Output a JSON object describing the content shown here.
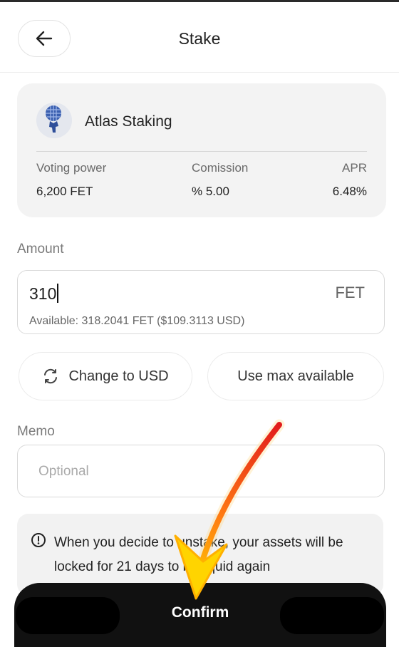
{
  "header": {
    "title": "Stake"
  },
  "validator": {
    "name": "Atlas Staking",
    "stats": [
      {
        "label": "Voting power",
        "value": "6,200 FET"
      },
      {
        "label": "Comission",
        "value": "% 5.00"
      },
      {
        "label": "APR",
        "value": "6.48%"
      }
    ]
  },
  "amount": {
    "label": "Amount",
    "value": "310",
    "unit": "FET",
    "available": "Available: 318.2041 FET ($109.3113 USD)"
  },
  "actions": {
    "change_currency": "Change to USD",
    "use_max": "Use max available"
  },
  "memo": {
    "label": "Memo",
    "placeholder": "Optional"
  },
  "notice": {
    "text": "When you decide to unstake, your assets will be locked for 21 days to be liquid again"
  },
  "confirm": {
    "label": "Confirm"
  },
  "colors": {
    "confirm_bg": "#111111",
    "card_bg": "#f3f3f3",
    "arrow_red": "#e8281a",
    "arrow_yellow": "#ffd400"
  }
}
